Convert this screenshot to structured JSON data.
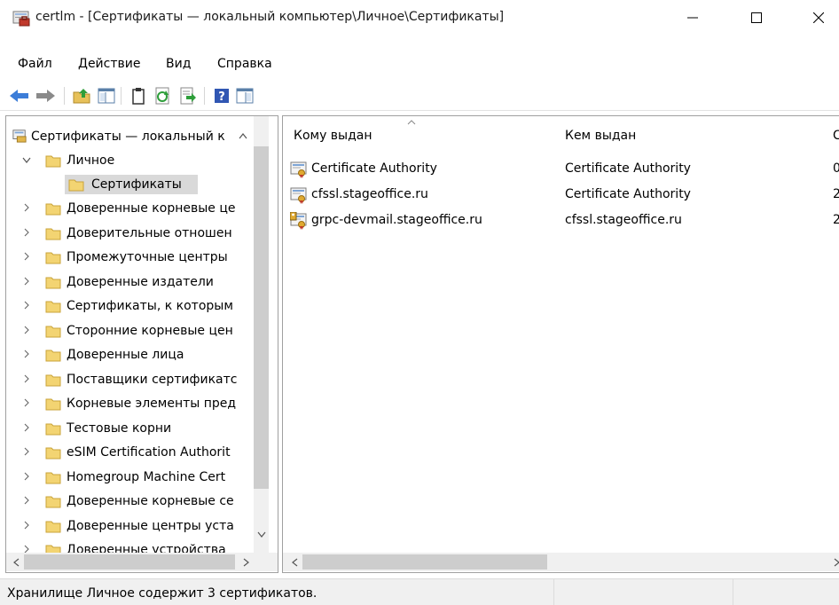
{
  "window": {
    "title": "certlm - [Сертификаты — локальный компьютер\\Личное\\Сертификаты]",
    "minimize_label": "Minimize",
    "maximize_label": "Maximize",
    "close_label": "Close"
  },
  "menu": {
    "items": [
      {
        "label": "Файл"
      },
      {
        "label": "Действие"
      },
      {
        "label": "Вид"
      },
      {
        "label": "Справка"
      }
    ]
  },
  "toolbar": {
    "buttons": [
      {
        "icon": "back-arrow-icon"
      },
      {
        "icon": "forward-arrow-icon"
      },
      {
        "icon": "up-folder-icon"
      },
      {
        "icon": "show-console-tree-icon"
      },
      {
        "icon": "clipboard-icon"
      },
      {
        "icon": "refresh-icon"
      },
      {
        "icon": "export-list-icon"
      },
      {
        "icon": "help-icon"
      },
      {
        "icon": "action-pane-icon"
      }
    ]
  },
  "tree": {
    "root_label": "Сертификаты — локальный к",
    "items": [
      {
        "label": "Личное",
        "expanded": true
      },
      {
        "label": "Сертификаты",
        "selected": true
      },
      {
        "label": "Доверенные корневые це"
      },
      {
        "label": "Доверительные отношен"
      },
      {
        "label": "Промежуточные центры"
      },
      {
        "label": "Доверенные издатели"
      },
      {
        "label": "Сертификаты, к которым"
      },
      {
        "label": "Сторонние корневые цен"
      },
      {
        "label": "Доверенные лица"
      },
      {
        "label": "Поставщики сертификатс"
      },
      {
        "label": "Корневые элементы пред"
      },
      {
        "label": "Тестовые корни"
      },
      {
        "label": "eSIM Certification Authorit"
      },
      {
        "label": "Homegroup Machine Cert"
      },
      {
        "label": "Доверенные корневые се"
      },
      {
        "label": "Доверенные центры уста"
      },
      {
        "label": "Доверенные устройства"
      }
    ]
  },
  "list": {
    "columns": [
      {
        "label": "Кому выдан"
      },
      {
        "label": "Кем выдан"
      },
      {
        "label": "С"
      }
    ],
    "rows": [
      {
        "issued_to": "Certificate Authority",
        "issued_by": "Certificate Authority",
        "extra": "0",
        "has_key": false
      },
      {
        "issued_to": "cfssl.stageoffice.ru",
        "issued_by": "Certificate Authority",
        "extra": "2",
        "has_key": false
      },
      {
        "issued_to": "grpc-devmail.stageoffice.ru",
        "issued_by": "cfssl.stageoffice.ru",
        "extra": "2",
        "has_key": true
      }
    ]
  },
  "status": {
    "text": "Хранилище Личное содержит 3 сертификатов."
  },
  "colors": {
    "accent": "#3c7dd8",
    "folder": "#f3d472",
    "selection": "#d9d9d9",
    "scrollbar_thumb": "#cdcdcd"
  }
}
